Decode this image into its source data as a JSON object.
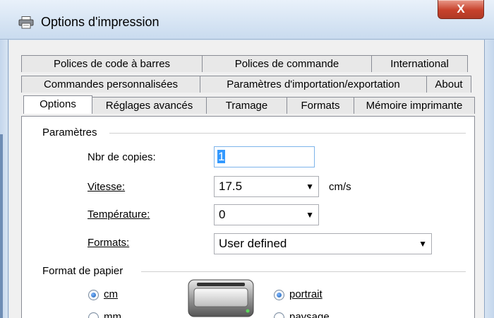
{
  "window": {
    "title": "Options d'impression",
    "close_glyph": "X"
  },
  "tabs": {
    "row1": [
      "Polices de code à barres",
      "Polices de commande",
      "International"
    ],
    "row2": [
      "Commandes personnalisées",
      "Paramètres d'importation/exportation",
      "About"
    ],
    "row3": [
      "Options",
      "Réglages avancés",
      "Tramage",
      "Formats",
      "Mémoire imprimante"
    ],
    "active": "Options"
  },
  "parametres": {
    "group_label": "Paramètres",
    "copies_label": "Nbr de copies:",
    "copies_value": "1",
    "vitesse_label": "Vitesse:",
    "vitesse_value": "17.5",
    "vitesse_unit": "cm/s",
    "temperature_label": "Température:",
    "temperature_value": "0",
    "formats_label": "Formats:",
    "formats_value": "User defined"
  },
  "format_papier": {
    "group_label": "Format de papier",
    "unit_cm": "cm",
    "unit_mm": "mm",
    "orientation_portrait": "portrait",
    "orientation_paysage": "paysage"
  },
  "icons": {
    "title": "printer-icon",
    "combo": "chevron-down-icon",
    "preview": "label-printer-image"
  },
  "colors": {
    "close_button": "#c7422c",
    "selection": "#3399ff",
    "focus_border": "#7eb4ea",
    "radio_dot": "#1a5fb0"
  }
}
